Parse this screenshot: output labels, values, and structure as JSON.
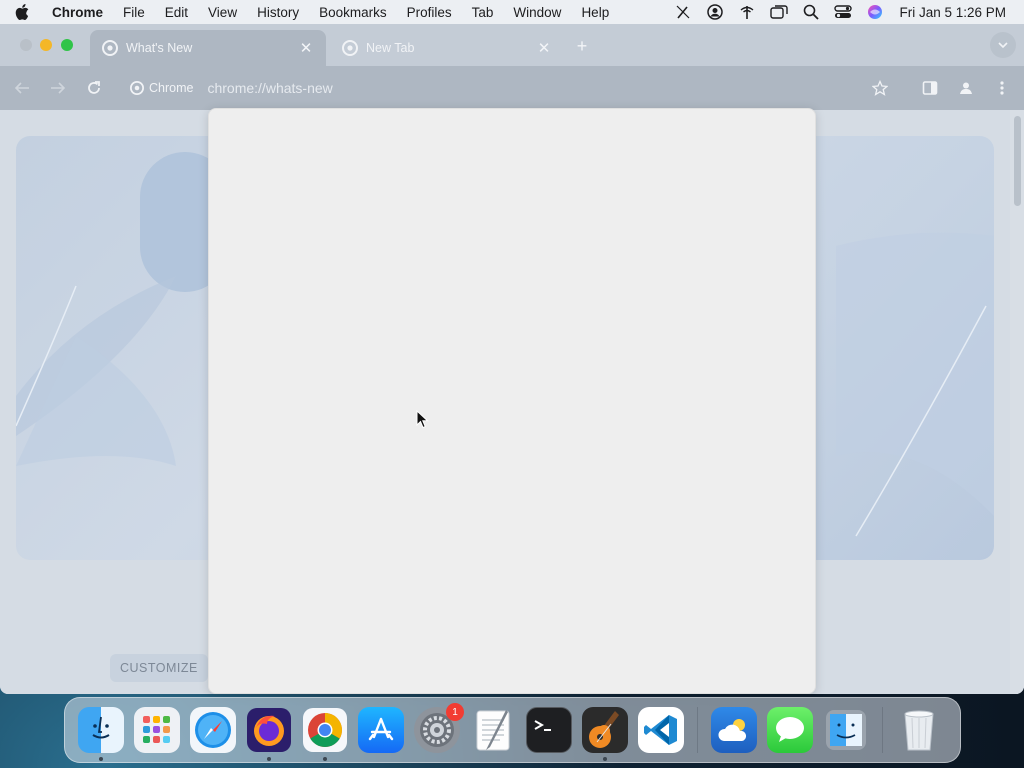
{
  "menubar": {
    "app_name": "Chrome",
    "items": [
      "File",
      "Edit",
      "View",
      "History",
      "Bookmarks",
      "Profiles",
      "Tab",
      "Window",
      "Help"
    ],
    "clock": "Fri Jan 5  1:26 PM"
  },
  "tabs": [
    {
      "title": "What's New",
      "active": true
    },
    {
      "title": "New Tab",
      "active": false
    }
  ],
  "omnibox": {
    "chip_label": "Chrome",
    "url_scheme": "chrome://",
    "url_path": "whats-new"
  },
  "content": {
    "customize_label": "CUSTOMIZE"
  },
  "dock": {
    "apps": [
      "Finder",
      "Launchpad",
      "Safari",
      "Firefox",
      "Chrome",
      "App Store",
      "System Settings",
      "TextEdit",
      "Terminal",
      "GarageBand",
      "Visual Studio Code",
      "Weather",
      "Messages",
      "Migration Assistant",
      "Trash"
    ],
    "system_settings_badge": "1"
  },
  "colors": {
    "menubar_bg": "#eceff3",
    "traffic_min": "#f4b728",
    "traffic_max": "#30c448",
    "badge_red": "#f23c32"
  }
}
